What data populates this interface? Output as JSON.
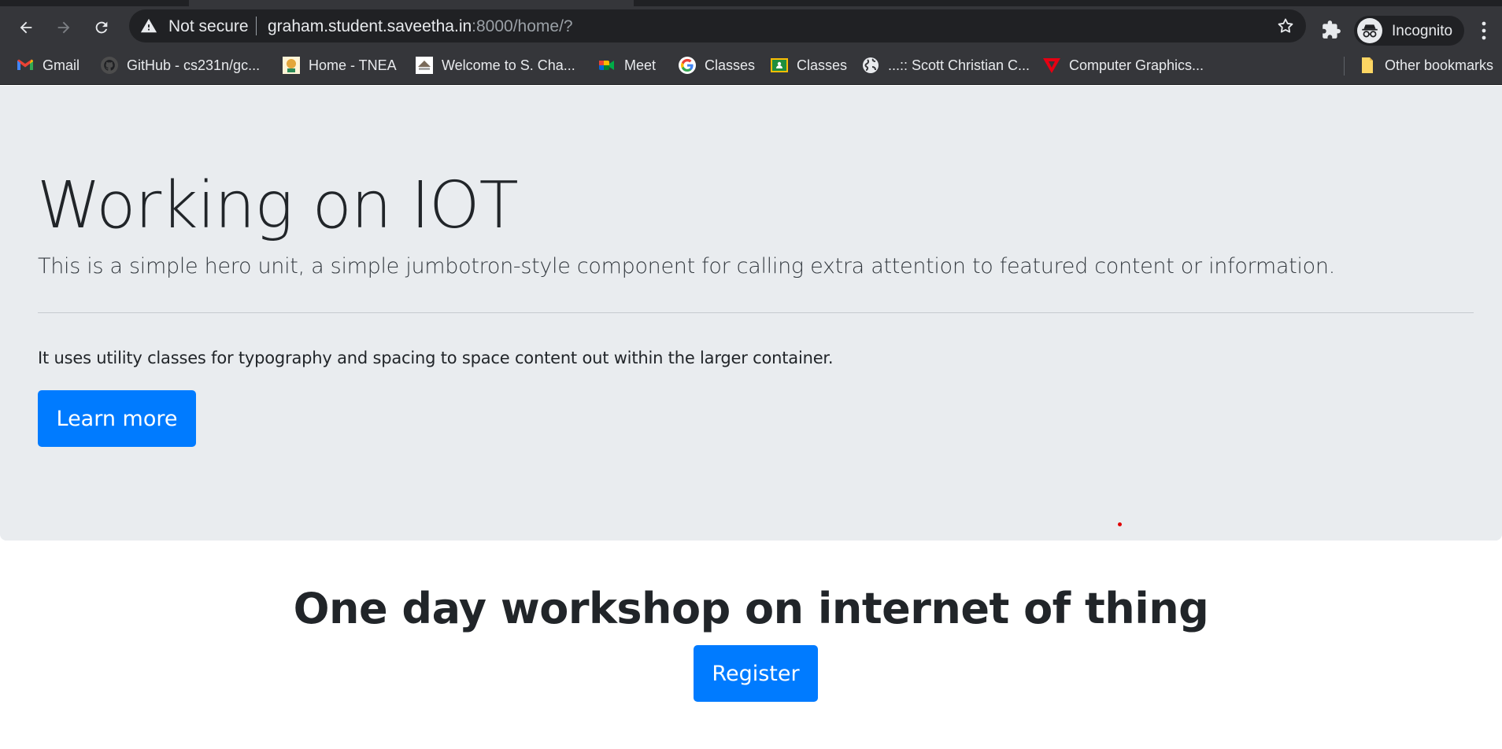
{
  "browser": {
    "omnibox": {
      "security_label": "Not secure",
      "url_host": "graham.student.saveetha.in",
      "url_path": ":8000/home/?"
    },
    "profile_label": "Incognito",
    "bookmarks": [
      {
        "label": "Gmail",
        "icon": "gmail-icon"
      },
      {
        "label": "GitHub - cs231n/gc...",
        "icon": "github-icon"
      },
      {
        "label": "Home - TNEA",
        "icon": "tnea-icon"
      },
      {
        "label": "Welcome to S. Cha...",
        "icon": "college-icon"
      },
      {
        "label": "Meet",
        "icon": "meet-icon"
      },
      {
        "label": "Classes",
        "icon": "google-icon"
      },
      {
        "label": "Classes",
        "icon": "classroom-icon"
      },
      {
        "label": "...:: Scott Christian C...",
        "icon": "globe-icon"
      },
      {
        "label": "Computer Graphics...",
        "icon": "tutorial-icon"
      }
    ],
    "other_bookmarks_label": "Other bookmarks"
  },
  "hero": {
    "title": "Working on IOT",
    "lead": "This is a simple hero unit, a simple jumbotron-style component for calling extra attention to featured content or information.",
    "body": "It uses utility classes for typography and spacing to space content out within the larger container.",
    "button_label": "Learn more"
  },
  "workshop": {
    "title": "One day workshop on internet of thing",
    "button_label": "Register"
  },
  "colors": {
    "primary": "#007bff",
    "jumbotron_bg": "#e9ecef",
    "chrome_toolbar": "#35363a",
    "chrome_omnibox": "#202124"
  }
}
